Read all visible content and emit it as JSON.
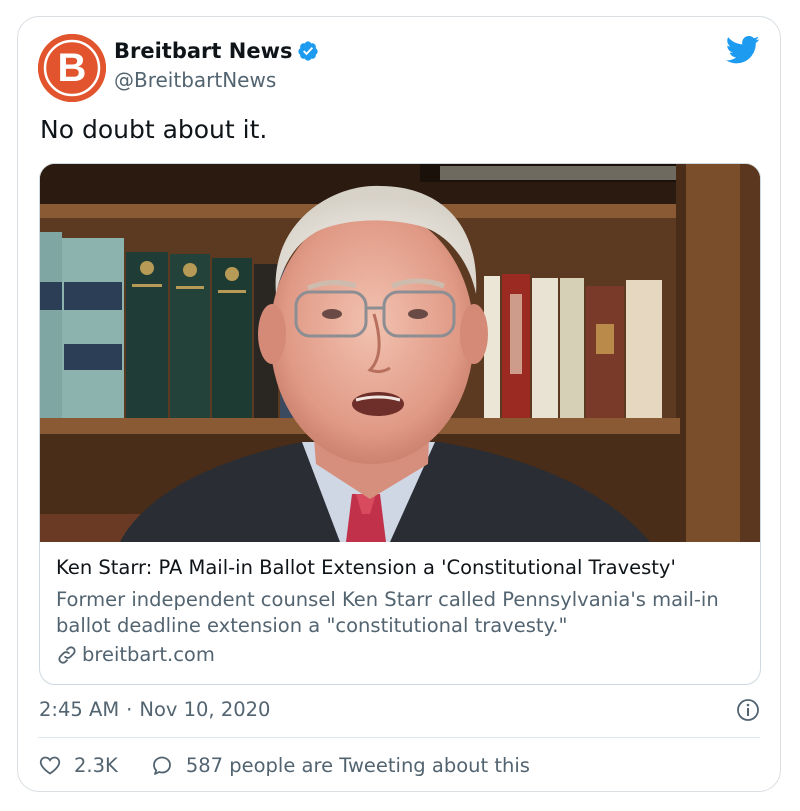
{
  "author": {
    "name": "Breitbart News",
    "handle": "@BreitbartNews",
    "avatar_letter": "B",
    "brand_color": "#e2542d",
    "verified": true
  },
  "tweet": {
    "text": "No doubt about it."
  },
  "link_card": {
    "title": "Ken Starr: PA Mail-in Ballot Extension a 'Constitutional Travesty'",
    "description": "Former independent counsel Ken Starr called Pennsylvania's mail-in ballot deadline extension a \"constitutional travesty.\"",
    "domain": "breitbart.com"
  },
  "meta": {
    "time": "2:45 AM",
    "separator": "·",
    "date": "Nov 10, 2020"
  },
  "actions": {
    "likes": "2.3K",
    "conversation": "587 people are Tweeting about this"
  },
  "colors": {
    "accent": "#1d9bf0",
    "muted_text": "#536471",
    "border": "#cfd9de"
  },
  "icons": [
    "twitter-bird-icon",
    "verified-badge-icon",
    "link-icon",
    "info-icon",
    "heart-icon",
    "speech-bubble-icon"
  ]
}
